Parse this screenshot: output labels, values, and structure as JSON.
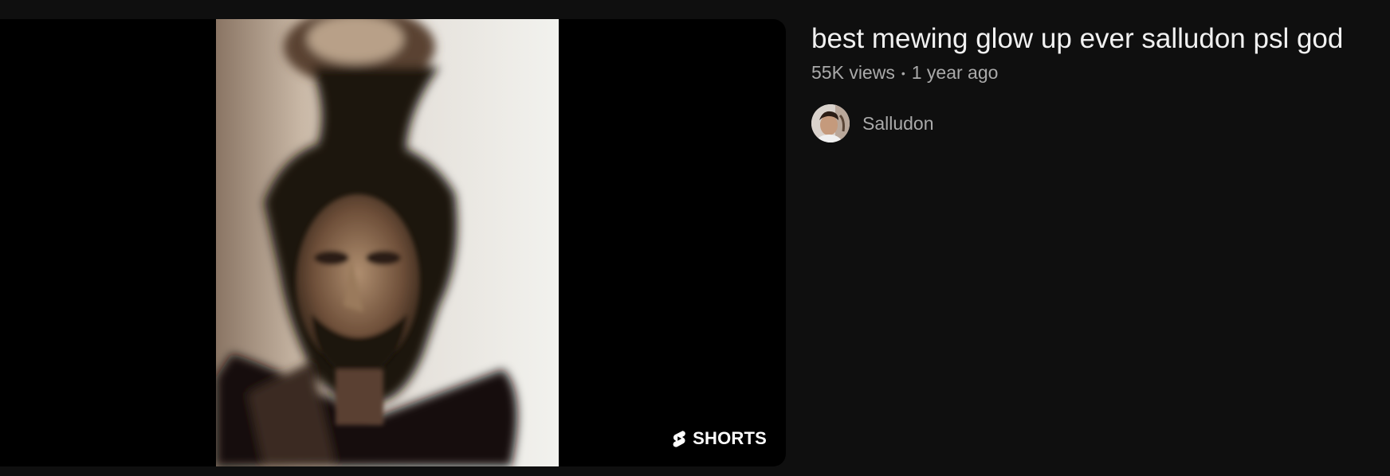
{
  "video": {
    "title": "best mewing glow up ever salludon psl god",
    "views": "55K views",
    "separator": "•",
    "age": "1 year ago",
    "badge_label": "SHORTS",
    "badge_icon": "shorts-icon"
  },
  "channel": {
    "name": "Salludon",
    "avatar_icon": "avatar"
  },
  "colors": {
    "background": "#0f0f0f",
    "title_text": "#f1f1f1",
    "meta_text": "#aaaaaa",
    "thumbnail_bg": "#000000"
  }
}
